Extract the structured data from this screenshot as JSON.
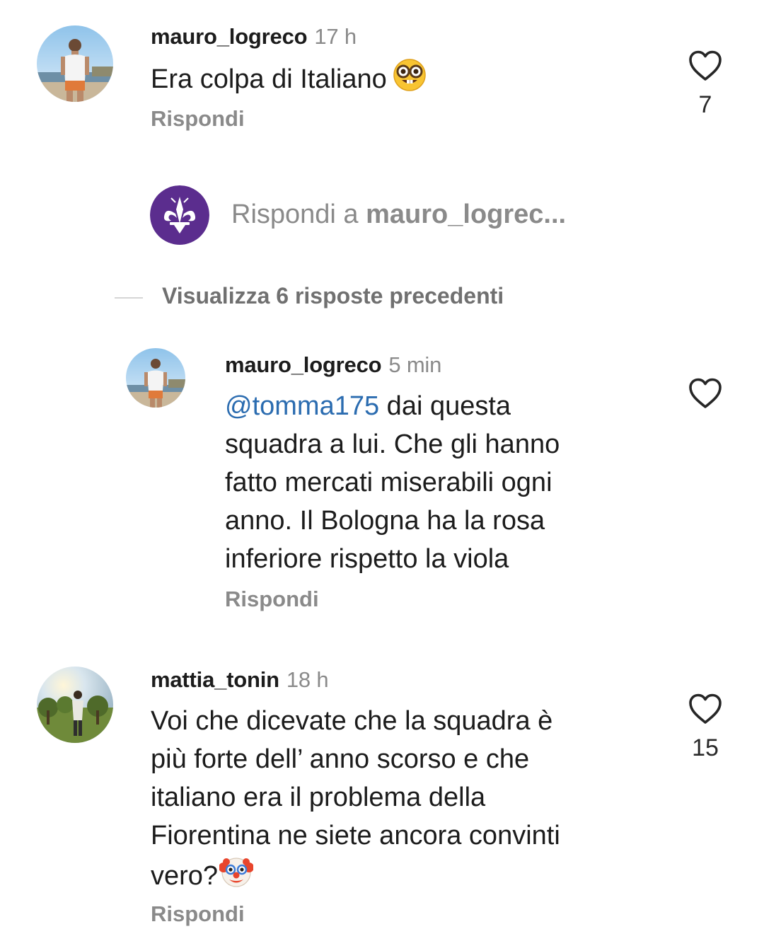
{
  "comments": [
    {
      "username": "mauro_logreco",
      "time": "17 h",
      "text": "Era colpa di Italiano",
      "emoji": "nerd-face",
      "reply_label": "Rispondi",
      "like_count": "7"
    },
    {
      "username": "mauro_logreco",
      "time": "5 min",
      "mention": "@tomma175",
      "text_line1_rest": " dai questa",
      "text_line2": "squadra a lui. Che gli hanno",
      "text_line3": "fatto mercati miserabili ogni",
      "text_line4": "anno. Il Bologna ha la rosa",
      "text_line5": "inferiore rispetto la viola",
      "reply_label": "Rispondi"
    },
    {
      "username": "mattia_tonin",
      "time": "18 h",
      "text_line1": "Voi che dicevate che la squadra è",
      "text_line2": "più forte dell’ anno scorso e che",
      "text_line3": "italiano era il problema della",
      "text_line4": "Fiorentina ne siete ancora convinti",
      "text_line5": "vero?",
      "emoji": "clown-face",
      "reply_label": "Rispondi",
      "like_count": "15"
    }
  ],
  "reply_box": {
    "prefix": "Rispondi a ",
    "target": "mauro_logrec..."
  },
  "view_previous": "Visualizza 6 risposte precedenti",
  "colors": {
    "secondary_text": "#8a8a8a",
    "mention": "#2b6cb0",
    "brand_purple": "#5b2d8e"
  }
}
